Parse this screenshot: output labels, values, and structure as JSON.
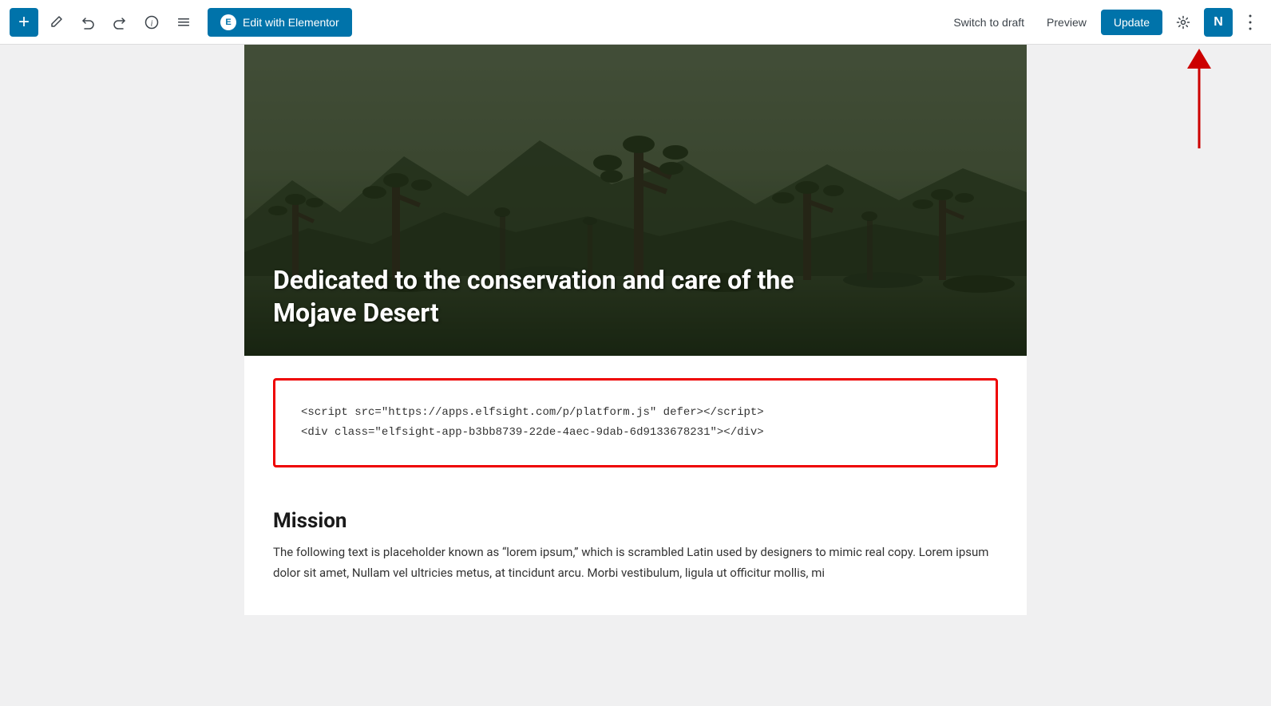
{
  "toolbar": {
    "add_label": "+",
    "elementor_label": "Edit with Elementor",
    "elementor_icon_letter": "E",
    "switch_draft_label": "Switch to draft",
    "preview_label": "Preview",
    "update_label": "Update",
    "n_label": "N"
  },
  "hero": {
    "title": "Dedicated to the conservation and care of the Mojave Desert"
  },
  "code_block": {
    "line1": "<script src=\"https://apps.elfsight.com/p/platform.js\" defer></script>",
    "line2": "<div class=\"elfsight-app-b3bb8739-22de-4aec-9dab-6d9133678231\"></div>"
  },
  "mission": {
    "heading": "Mission",
    "body": "The following text is placeholder known as “lorem ipsum,” which is scrambled Latin used by designers to mimic real copy. Lorem ipsum dolor sit amet, Nullam vel ultricies metus, at tincidunt arcu. Morbi vestibulum, ligula ut officitur mollis, mi"
  }
}
